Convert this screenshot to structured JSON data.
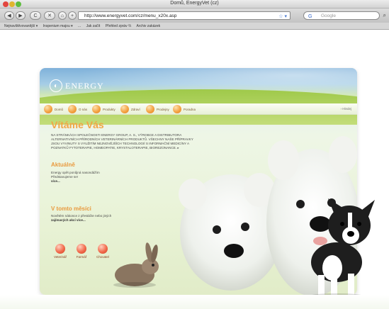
{
  "window": {
    "title": "Domů, EnergyVet (cz)",
    "url": "http://www.energyvet.com/cz/menu_x20x.asp",
    "search_placeholder": "Google",
    "search_engine_logo": "G"
  },
  "toolbar": {
    "back_icon": "◀",
    "forward_icon": "▶",
    "reload_icon": "C",
    "stop_icon": "✕",
    "home_icon": "⌂",
    "add_icon": "+",
    "rss_icon": "☆ ▾",
    "search_icon": "⌕"
  },
  "bookmarks": [
    "Nejnavštěvovanější ▾",
    "Inspenium majou ▾",
    "...",
    "Jak začít",
    "Přehled zpráv ⅔",
    "Archiv zakázek"
  ],
  "site": {
    "logo_text": "ENERGY",
    "nav": [
      "Domů",
      "O nás",
      "Produkty",
      "Zdraví",
      "Prodejny",
      "Poradna"
    ],
    "nav_right": "› Hledej",
    "welcome": "Vítáme Vás",
    "intro": "Na stránkách společnosti ENERGY GROUP, a. s., výrobce a distributora alternativních přírodních veterinárních produktů. Všechny naše přípravky jsou vyvinuty s využitím nejnovějších technologií s informační medicíny a poznatků fytoterapie, homeopatie, krystaloterapie, biorezonance. ▸",
    "news": {
      "title": "Aktuálně",
      "lines": [
        "Energy opět ponůjná nasondážím",
        "Představujeme se!"
      ],
      "more": "více..."
    },
    "month": {
      "title": "V tomto měsíci",
      "lines": [
        "Novětém nákonce z přestáčte nebo jiných"
      ],
      "more": "zajímavých akcí více..."
    },
    "bottom_buttons": [
      "Veterinář",
      "Farmář",
      "Chovatel"
    ]
  }
}
